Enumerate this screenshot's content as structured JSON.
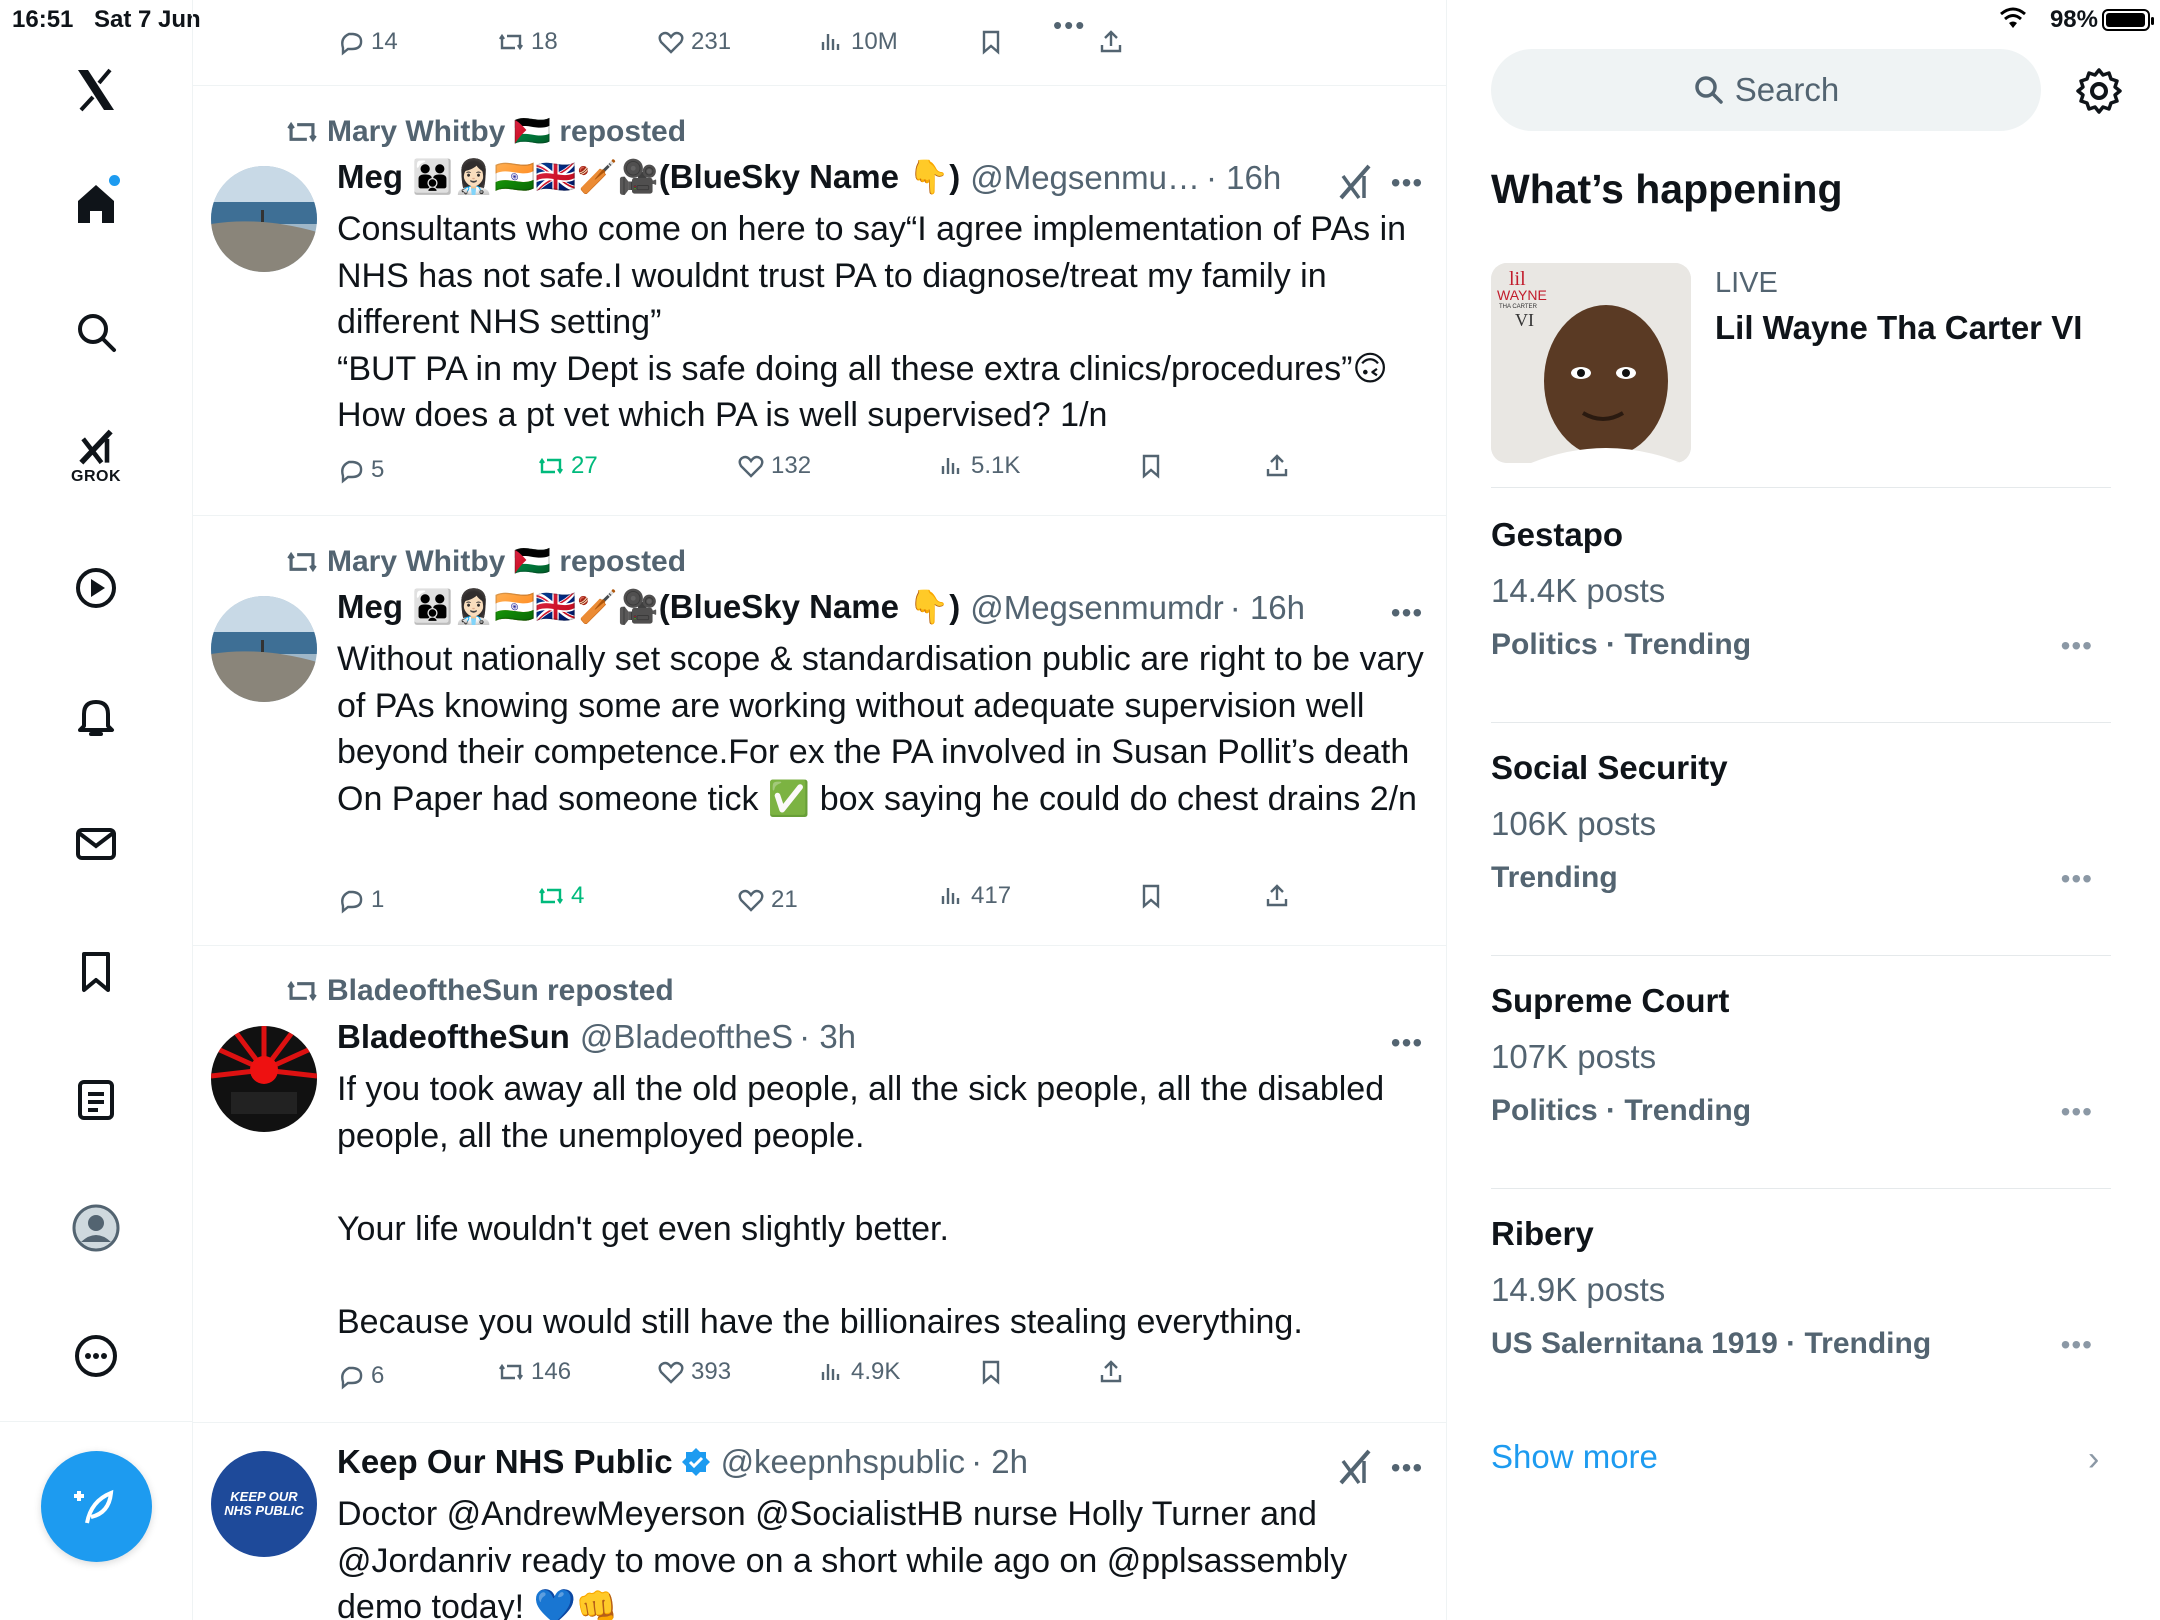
{
  "status": {
    "time": "16:51",
    "date": "Sat 7 Jun",
    "battery": "98%"
  },
  "nav": {
    "grok_label": "GROK",
    "items": [
      "home",
      "explore",
      "grok",
      "video",
      "notifications",
      "messages",
      "bookmarks",
      "lists",
      "profile",
      "more"
    ]
  },
  "top_post_actions": {
    "replies": "14",
    "reposts": "18",
    "likes": "231",
    "views": "10M"
  },
  "posts": [
    {
      "reposted_by": "Mary Whitby 🇵🇸 reposted",
      "name": "Meg 🧑‍🧑‍🧒👩🏻‍⚕️🇮🇳🇬🇧🏏🎥(BlueSky Name 👇)",
      "handle": "@Megsenmu…",
      "time": "· 16h",
      "body": "Consultants who come on here to say“I agree implementation of PAs in NHS has not safe.I wouldnt trust PA to diagnose/treat my family in different NHS setting”\n“BUT PA in my Dept is safe doing all these extra clinics/procedures”🙃\nHow does a pt vet which PA is well supervised? 1/n",
      "replies": "5",
      "reposts": "27",
      "likes": "132",
      "views": "5.1K"
    },
    {
      "reposted_by": "Mary Whitby 🇵🇸 reposted",
      "name": "Meg 🧑‍🧑‍🧒👩🏻‍⚕️🇮🇳🇬🇧🏏🎥(BlueSky Name 👇)",
      "handle": "@Megsenmumdr",
      "time": "· 16h",
      "body": "Without nationally set scope & standardisation public are right to be vary of PAs knowing some are working without adequate supervision well beyond their competence.For ex the PA involved in Susan Pollit’s death\nOn Paper had someone tick ✅ box saying he could do chest drains 2/n",
      "replies": "1",
      "reposts": "4",
      "likes": "21",
      "views": "417"
    },
    {
      "reposted_by": "BladeoftheSun reposted",
      "name": "BladeoftheSun",
      "handle": "@BladeoftheS",
      "time": "· 3h",
      "body": "If you took away all the old people, all the sick people, all the disabled people, all the unemployed people.\n\nYour life wouldn't get even slightly better.\n\nBecause you would still have the billionaires stealing everything.",
      "replies": "6",
      "reposts": "146",
      "likes": "393",
      "views": "4.9K"
    },
    {
      "name": "Keep Our NHS Public",
      "handle": "@keepnhspublic",
      "time": "· 2h",
      "avatar_text": "KEEP OUR NHS PUBLIC",
      "body": "Doctor @AndrewMeyerson @SocialistHB nurse Holly Turner and @Jordanriv ready to move on a short while ago on @pplsassembly demo today! 💙👊"
    }
  ],
  "sidebar": {
    "search_placeholder": "Search",
    "heading": "What’s happening",
    "live": {
      "tag": "LIVE",
      "title": "Lil Wayne Tha Carter VI",
      "cover_text_1": "lil",
      "cover_text_2": "WAYNE",
      "cover_text_3": "THA CARTER",
      "cover_text_4": "VI"
    },
    "trends": [
      {
        "name": "Gestapo",
        "posts": "14.4K posts",
        "category": "Politics · Trending"
      },
      {
        "name": "Social Security",
        "posts": "106K posts",
        "category": "Trending"
      },
      {
        "name": "Supreme Court",
        "posts": "107K posts",
        "category": "Politics · Trending"
      },
      {
        "name": "Ribery",
        "posts": "14.9K posts",
        "category": "US Salernitana 1919 · Trending"
      }
    ],
    "show_more": "Show more"
  },
  "colors": {
    "accent": "#1d9bf0",
    "repost_active": "#00ba7c",
    "secondary_text": "#536471"
  }
}
